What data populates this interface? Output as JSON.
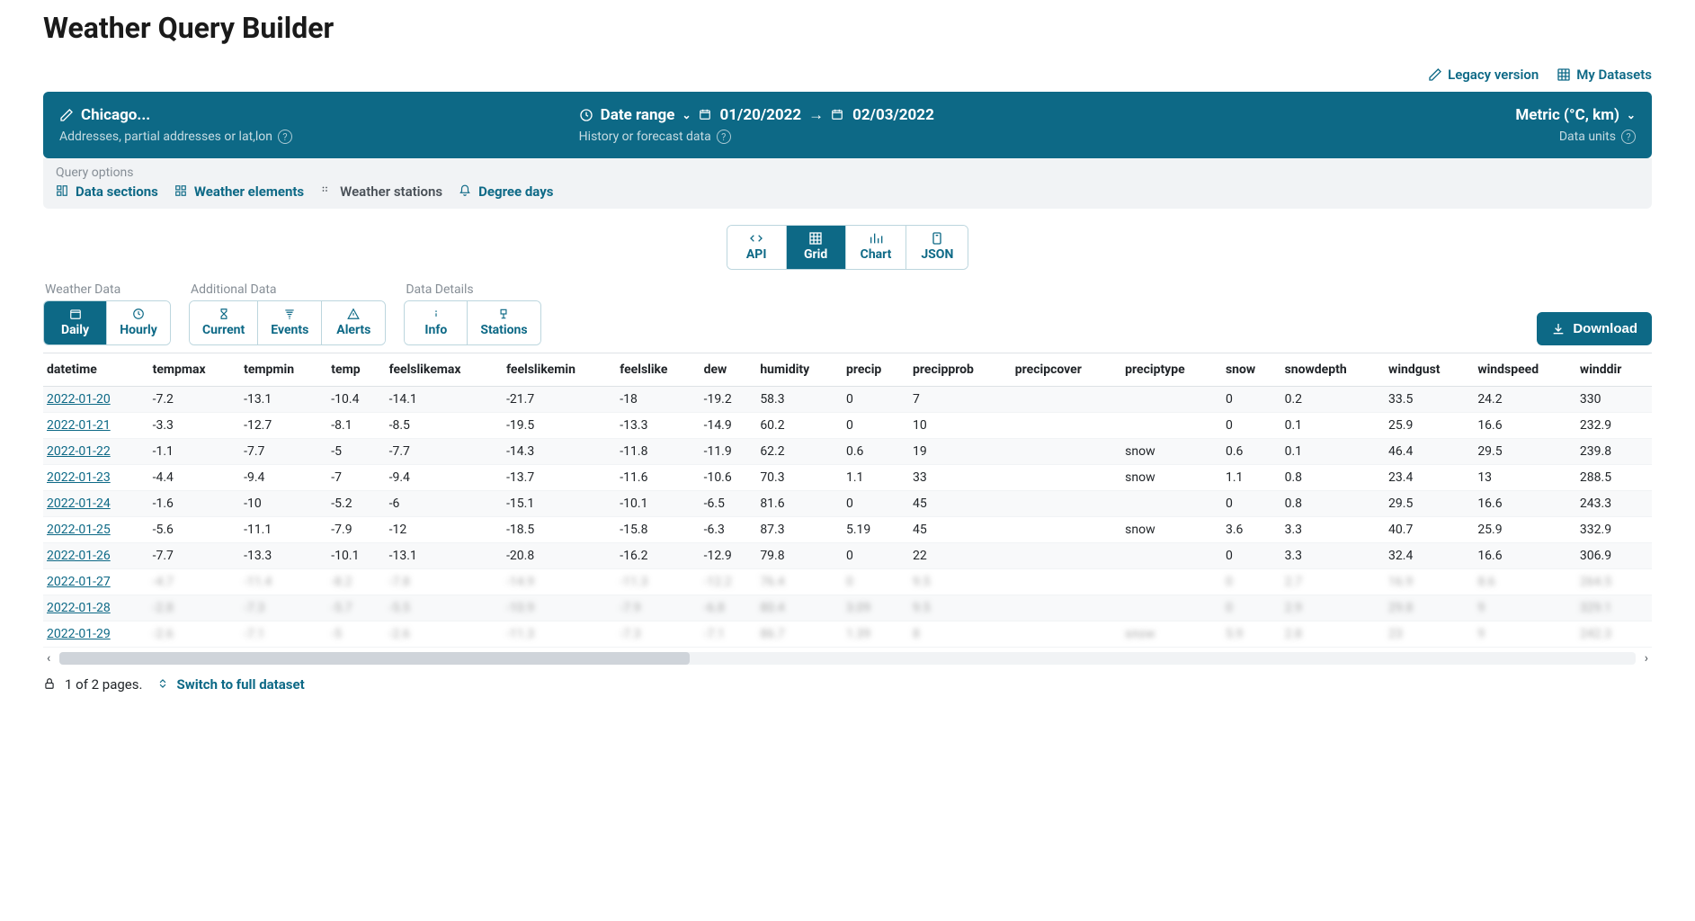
{
  "title": "Weather Query Builder",
  "top_links": {
    "legacy": "Legacy version",
    "datasets": "My Datasets"
  },
  "query_bar": {
    "location": "Chicago...",
    "location_hint": "Addresses, partial addresses or lat,lon",
    "date_label": "Date range",
    "date_start": "01/20/2022",
    "date_end": "02/03/2022",
    "date_hint": "History or forecast data",
    "units_label": "Metric (°C, km)",
    "units_hint": "Data units"
  },
  "options": {
    "label": "Query options",
    "data_sections": "Data sections",
    "weather_elements": "Weather elements",
    "weather_stations": "Weather stations",
    "degree_days": "Degree days"
  },
  "view_tabs": {
    "api": "API",
    "grid": "Grid",
    "chart": "Chart",
    "json": "JSON"
  },
  "subgroups": {
    "weather_data": "Weather Data",
    "additional_data": "Additional Data",
    "data_details": "Data Details",
    "daily": "Daily",
    "hourly": "Hourly",
    "current": "Current",
    "events": "Events",
    "alerts": "Alerts",
    "info": "Info",
    "stations": "Stations"
  },
  "download": "Download",
  "columns": [
    "datetime",
    "tempmax",
    "tempmin",
    "temp",
    "feelslikemax",
    "feelslikemin",
    "feelslike",
    "dew",
    "humidity",
    "precip",
    "precipprob",
    "precipcover",
    "preciptype",
    "snow",
    "snowdepth",
    "windgust",
    "windspeed",
    "winddir"
  ],
  "rows": [
    {
      "blurred": false,
      "cells": [
        "2022-01-20",
        "-7.2",
        "-13.1",
        "-10.4",
        "-14.1",
        "-21.7",
        "-18",
        "-19.2",
        "58.3",
        "0",
        "7",
        "",
        "",
        "0",
        "0.2",
        "33.5",
        "24.2",
        "330"
      ]
    },
    {
      "blurred": false,
      "cells": [
        "2022-01-21",
        "-3.3",
        "-12.7",
        "-8.1",
        "-8.5",
        "-19.5",
        "-13.3",
        "-14.9",
        "60.2",
        "0",
        "10",
        "",
        "",
        "0",
        "0.1",
        "25.9",
        "16.6",
        "232.9"
      ]
    },
    {
      "blurred": false,
      "cells": [
        "2022-01-22",
        "-1.1",
        "-7.7",
        "-5",
        "-7.7",
        "-14.3",
        "-11.8",
        "-11.9",
        "62.2",
        "0.6",
        "19",
        "",
        "snow",
        "0.6",
        "0.1",
        "46.4",
        "29.5",
        "239.8"
      ]
    },
    {
      "blurred": false,
      "cells": [
        "2022-01-23",
        "-4.4",
        "-9.4",
        "-7",
        "-9.4",
        "-13.7",
        "-11.6",
        "-10.6",
        "70.3",
        "1.1",
        "33",
        "",
        "snow",
        "1.1",
        "0.8",
        "23.4",
        "13",
        "288.5"
      ]
    },
    {
      "blurred": false,
      "cells": [
        "2022-01-24",
        "-1.6",
        "-10",
        "-5.2",
        "-6",
        "-15.1",
        "-10.1",
        "-6.5",
        "81.6",
        "0",
        "45",
        "",
        "",
        "0",
        "0.8",
        "29.5",
        "16.6",
        "243.3"
      ]
    },
    {
      "blurred": false,
      "cells": [
        "2022-01-25",
        "-5.6",
        "-11.1",
        "-7.9",
        "-12",
        "-18.5",
        "-15.8",
        "-6.3",
        "87.3",
        "5.19",
        "45",
        "",
        "snow",
        "3.6",
        "3.3",
        "40.7",
        "25.9",
        "332.9"
      ]
    },
    {
      "blurred": false,
      "cells": [
        "2022-01-26",
        "-7.7",
        "-13.3",
        "-10.1",
        "-13.1",
        "-20.8",
        "-16.2",
        "-12.9",
        "79.8",
        "0",
        "22",
        "",
        "",
        "0",
        "3.3",
        "32.4",
        "16.6",
        "306.9"
      ]
    },
    {
      "blurred": true,
      "cells": [
        "2022-01-27",
        "-4.7",
        "-11.4",
        "-8.2",
        "-7.8",
        "-14.9",
        "-11.3",
        "-12.2",
        "76.4",
        "0",
        "9.5",
        "",
        "",
        "0",
        "2.7",
        "16.9",
        "8.6",
        "264.5"
      ]
    },
    {
      "blurred": true,
      "cells": [
        "2022-01-28",
        "-2.8",
        "-7.3",
        "-5.7",
        "-5.5",
        "-10.9",
        "-7.9",
        "-6.8",
        "80.4",
        "3.09",
        "9.5",
        "",
        "",
        "0",
        "2.9",
        "29.8",
        "9",
        "329.1"
      ]
    },
    {
      "blurred": true,
      "cells": [
        "2022-01-29",
        "-2.6",
        "-7.1",
        "-5",
        "-2.6",
        "-11.3",
        "-7.3",
        "-7.1",
        "86.7",
        "1.39",
        "8",
        "",
        "snow",
        "5.9",
        "2.8",
        "23",
        "9",
        "242.3"
      ]
    }
  ],
  "footer": {
    "pages": "1 of 2 pages.",
    "switch": "Switch to full dataset"
  }
}
